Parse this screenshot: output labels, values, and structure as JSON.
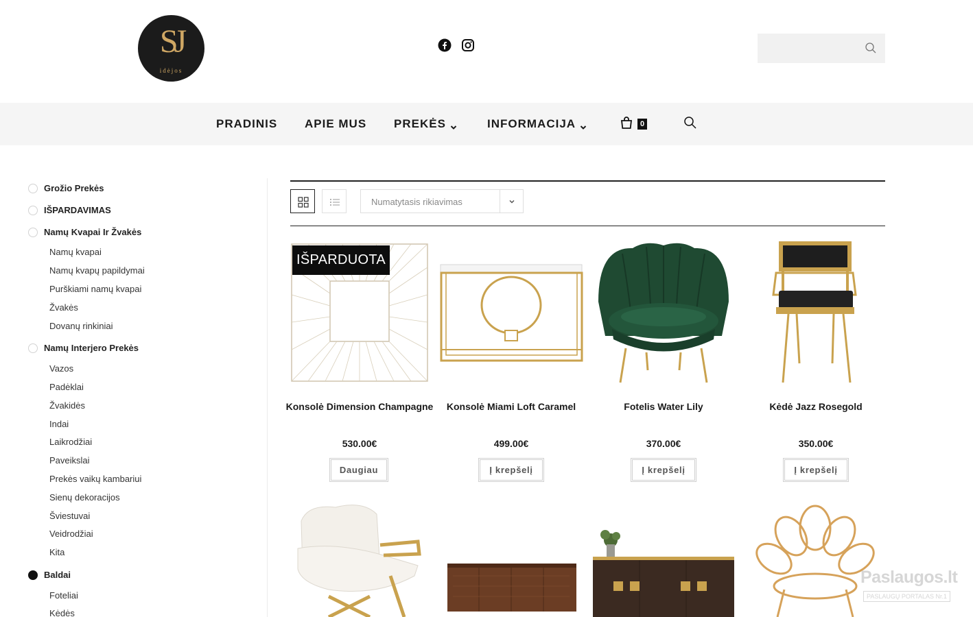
{
  "header": {
    "logo": {
      "mark": "SJ",
      "sub": "idėjos"
    },
    "social": [
      {
        "icon": "facebook-icon"
      },
      {
        "icon": "instagram-icon"
      }
    ],
    "search": {
      "value": "",
      "placeholder": ""
    }
  },
  "nav": {
    "items": [
      {
        "label": "PRADINIS",
        "has_dropdown": false
      },
      {
        "label": "APIE MUS",
        "has_dropdown": false
      },
      {
        "label": "PREKĖS",
        "has_dropdown": true
      },
      {
        "label": "INFORMACIJA",
        "has_dropdown": true
      }
    ],
    "cart_count": "0"
  },
  "sidebar": {
    "categories": [
      {
        "label": "Grožio Prekės",
        "selected": false,
        "children": []
      },
      {
        "label": "IŠPARDAVIMAS",
        "selected": false,
        "children": []
      },
      {
        "label": "Namų Kvapai Ir Žvakės",
        "selected": false,
        "children": [
          "Namų kvapai",
          "Namų kvapų papildymai",
          "Purškiami namų kvapai",
          "Žvakės",
          "Dovanų rinkiniai"
        ]
      },
      {
        "label": "Namų Interjero Prekės",
        "selected": false,
        "children": [
          "Vazos",
          "Padėklai",
          "Žvakidės",
          "Indai",
          "Laikrodžiai",
          "Paveikslai",
          "Prekės vaikų kambariui",
          "Sienų dekoracijos",
          "Šviestuvai",
          "Veidrodžiai",
          "Kita"
        ]
      },
      {
        "label": "Baldai",
        "selected": true,
        "children": [
          "Foteliai",
          "Kėdės"
        ]
      }
    ]
  },
  "toolbar": {
    "view_modes": [
      "grid",
      "list"
    ],
    "active_view": "grid",
    "sort_selected": "Numatytasis rikiavimas"
  },
  "products": [
    {
      "title": "Konsolė Dimension Champagne",
      "price": "530.00€",
      "button": "Daugiau",
      "badge": "IŠPARDUOTA"
    },
    {
      "title": "Konsolė Miami Loft Caramel",
      "price": "499.00€",
      "button": "Į krepšelį",
      "badge": ""
    },
    {
      "title": "Fotelis Water Lily",
      "price": "370.00€",
      "button": "Į krepšelį",
      "badge": ""
    },
    {
      "title": "Kėdė Jazz Rosegold",
      "price": "350.00€",
      "button": "Į krepšelį",
      "badge": ""
    }
  ],
  "products_row2": [
    {
      "name": "white-fur-armchair"
    },
    {
      "name": "wooden-sideboard"
    },
    {
      "name": "dark-sideboard-with-plant"
    },
    {
      "name": "rattan-chair"
    }
  ],
  "watermark": {
    "line1": "Paslaugos.lt",
    "line2": "PASLAUGŲ PORTALAS  Nr.1"
  },
  "colors": {
    "accent_gold": "#cfa764",
    "dark": "#111111",
    "nav_bg": "#f5f5f5"
  }
}
